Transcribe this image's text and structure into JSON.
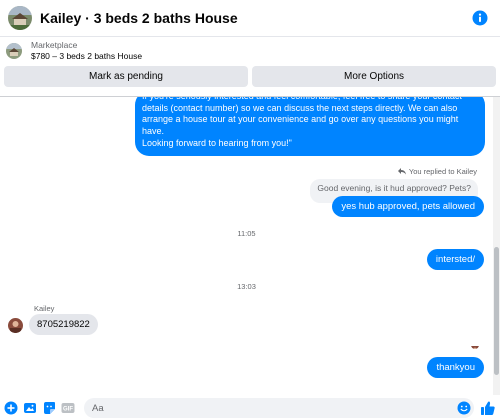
{
  "header": {
    "title": "Kailey · 3 beds 2 baths House",
    "avatar_icon": "house-photo-icon",
    "info_icon": "info-icon"
  },
  "marketplace": {
    "label": "Marketplace",
    "listing": "$780 – 3 beds 2 baths House",
    "buttons": {
      "mark_pending": "Mark as pending",
      "more_options": "More Options"
    }
  },
  "messages": {
    "outgoing_long": [
      "If you're seriously interested and feel comfortable, feel free to share your contact details (contact number) so we can discuss the next steps directly. We can also arrange a house tour at your convenience and go over any questions you might have.",
      "Looking forward to hearing from you!\""
    ],
    "replied_label": "You replied to Kailey",
    "quoted_text": "Good evening, is it hud approved? Pets?",
    "reply_text": "yes hub approved, pets allowed",
    "time_1": "11:05",
    "msg_interested": "intersted/",
    "time_2": "13:03",
    "sender_name": "Kailey",
    "incoming_number": "8705219822",
    "msg_thankyou": "thankyou"
  },
  "composer": {
    "placeholder": "Aa",
    "icons": [
      "plus-icon",
      "photo-icon",
      "sticker-icon",
      "gif-icon",
      "emoji-icon",
      "thumbs-up-icon"
    ],
    "gif_label": "GIF"
  },
  "colors": {
    "accent": "#0084ff",
    "bubble_in": "#e4e6eb",
    "muted_text": "#65676b"
  }
}
